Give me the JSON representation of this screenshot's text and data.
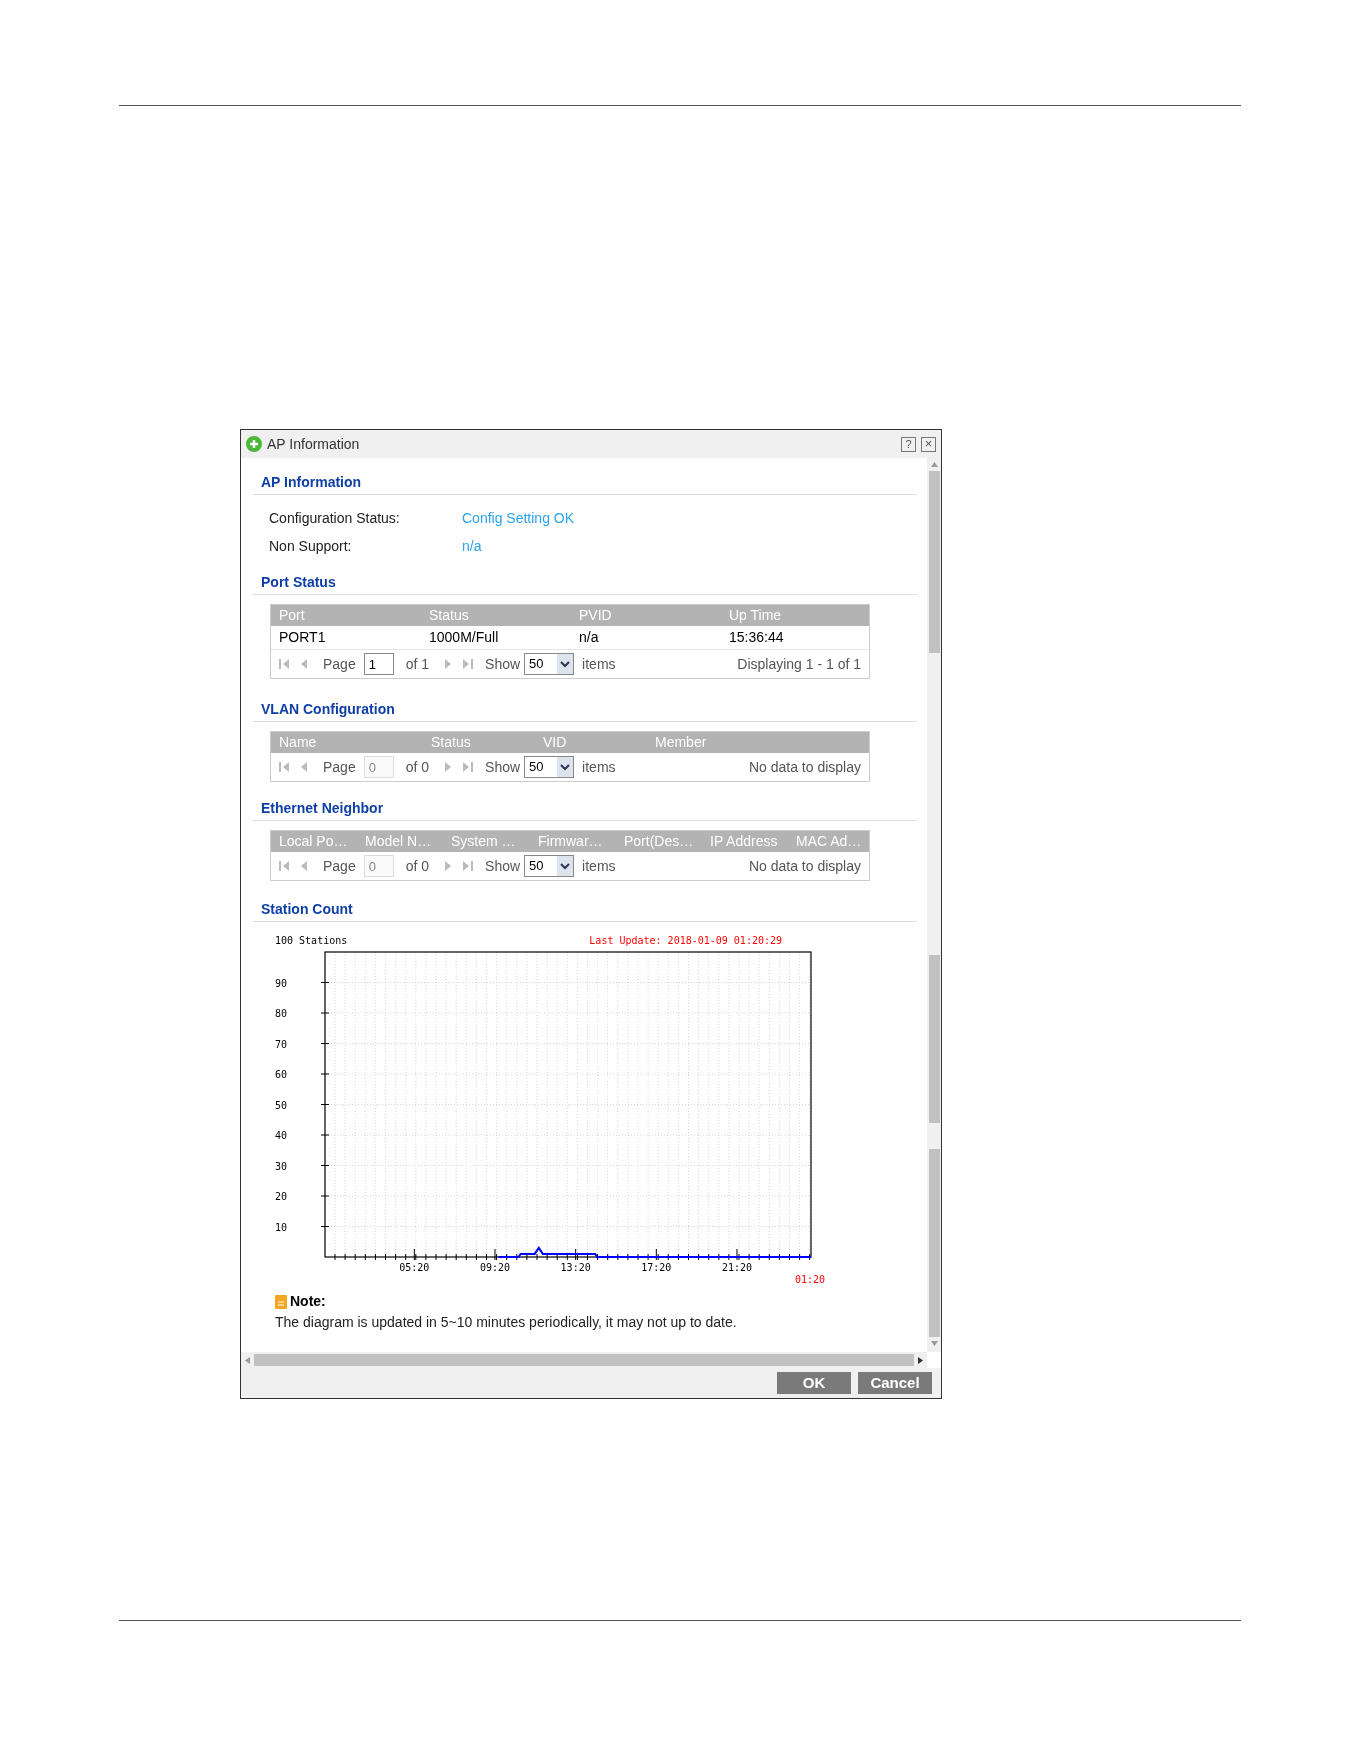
{
  "dialog": {
    "title": "AP Information",
    "help_button": "?",
    "close_button": "×"
  },
  "ap_information": {
    "heading": "AP Information",
    "fields": [
      {
        "label": "Configuration Status:",
        "value": "Config Setting OK"
      },
      {
        "label": "Non Support:",
        "value": "n/a"
      }
    ]
  },
  "port_status": {
    "heading": "Port Status",
    "columns": [
      "Port",
      "Status",
      "PVID",
      "Up Time"
    ],
    "rows": [
      [
        "PORT1",
        "1000M/Full",
        "n/a",
        "15:36:44"
      ]
    ],
    "pager": {
      "page_label": "Page",
      "page": "1",
      "page_enabled": true,
      "of": "of 1",
      "show_label": "Show",
      "show": "50",
      "items_label": "items",
      "summary": "Displaying 1 - 1 of 1"
    }
  },
  "vlan_configuration": {
    "heading": "VLAN Configuration",
    "columns": [
      "Name",
      "Status",
      "VID",
      "Member"
    ],
    "pager": {
      "page_label": "Page",
      "page": "0",
      "page_enabled": false,
      "of": "of 0",
      "show_label": "Show",
      "show": "50",
      "items_label": "items",
      "summary": "No data to display"
    }
  },
  "ethernet_neighbor": {
    "heading": "Ethernet Neighbor",
    "columns": [
      "Local Po…",
      "Model N…",
      "System …",
      "Firmwar…",
      "Port(Des…",
      "IP Address",
      "MAC Ad…"
    ],
    "pager": {
      "page_label": "Page",
      "page": "0",
      "page_enabled": false,
      "of": "of 0",
      "show_label": "Show",
      "show": "50",
      "items_label": "items",
      "summary": "No data to display"
    }
  },
  "station_count": {
    "heading": "Station Count",
    "unit_label": "100 Stations",
    "last_update": "Last Update: 2018-01-09 01:20:29",
    "end_label": "01:20",
    "chart_data": {
      "type": "line",
      "grid": true,
      "x": [
        9.5,
        10.5,
        10.6,
        11.3,
        11.5,
        11.7,
        14.3,
        14.4,
        25.0
      ],
      "xlim": [
        0.9,
        25.0
      ],
      "ylim": [
        0,
        100
      ],
      "xticks": [
        {
          "value": 5.33,
          "label": "05:20"
        },
        {
          "value": 9.33,
          "label": "09:20"
        },
        {
          "value": 13.33,
          "label": "13:20"
        },
        {
          "value": 17.33,
          "label": "17:20"
        },
        {
          "value": 21.33,
          "label": "21:20"
        }
      ],
      "yticks": [
        10,
        20,
        30,
        40,
        50,
        60,
        70,
        80,
        90
      ],
      "series": [
        {
          "color": "#0000ff",
          "values": [
            0,
            0,
            1,
            1,
            3,
            1,
            1,
            0,
            0
          ]
        }
      ]
    }
  },
  "note": {
    "title": "Note:",
    "text": "The diagram is updated in 5~10 minutes periodically, it may not up to date."
  },
  "buttons": [
    "OK",
    "Cancel"
  ]
}
